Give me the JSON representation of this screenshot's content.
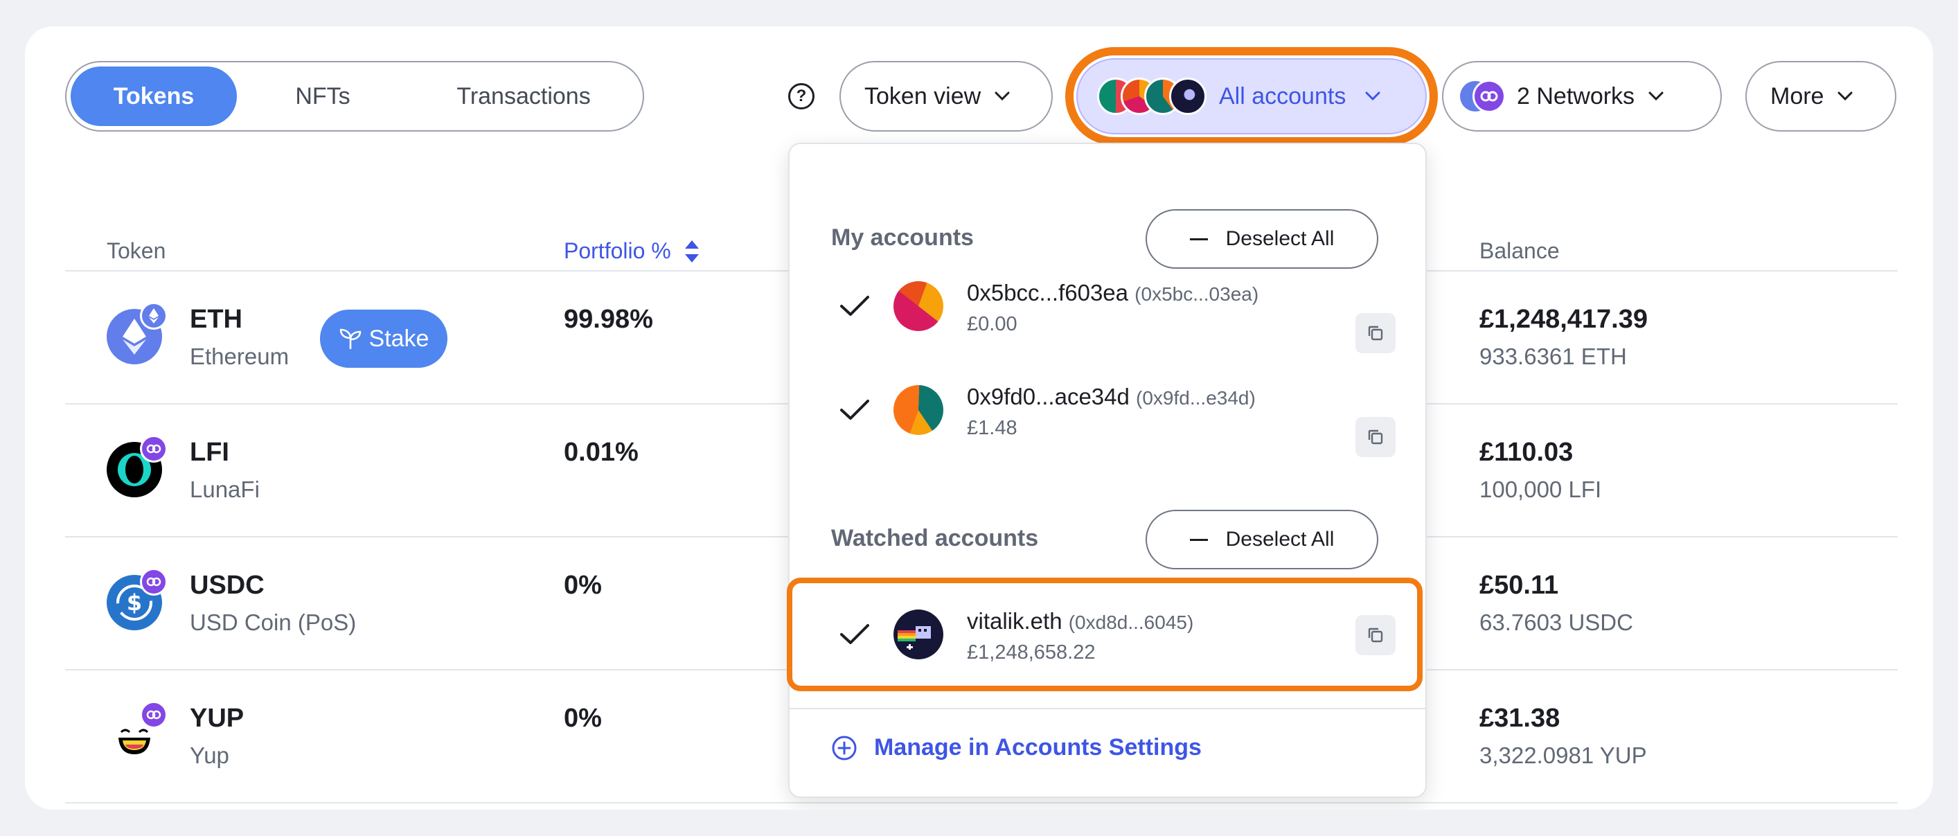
{
  "tabs": [
    {
      "label": "Tokens"
    },
    {
      "label": "NFTs"
    },
    {
      "label": "Transactions"
    }
  ],
  "toolbar": {
    "help_symbol": "?",
    "token_view_label": "Token view",
    "all_accounts_label": "All accounts",
    "networks_label": "2 Networks",
    "more_label": "More"
  },
  "table": {
    "headers": {
      "token": "Token",
      "portfolio": "Portfolio %",
      "balance": "Balance"
    },
    "rows": [
      {
        "symbol": "ETH",
        "name": "Ethereum",
        "portfolio": "99.98%",
        "balance": "£1,248,417.39",
        "amount": "933.6361 ETH"
      },
      {
        "symbol": "LFI",
        "name": "LunaFi",
        "portfolio": "0.01%",
        "balance": "£110.03",
        "amount": "100,000 LFI"
      },
      {
        "symbol": "USDC",
        "name": "USD Coin (PoS)",
        "portfolio": "0%",
        "balance": "£50.11",
        "amount": "63.7603 USDC"
      },
      {
        "symbol": "YUP",
        "name": "Yup",
        "portfolio": "0%",
        "balance": "£31.38",
        "amount": "3,322.0981 YUP"
      }
    ],
    "stake_label": "Stake"
  },
  "dropdown": {
    "my_accounts_title": "My accounts",
    "watched_accounts_title": "Watched accounts",
    "deselect_label": "Deselect All",
    "my_accounts": [
      {
        "name": "0x5bcc...f603ea",
        "short": "(0x5bc...03ea)",
        "balance": "£0.00"
      },
      {
        "name": "0x9fd0...ace34d",
        "short": "(0x9fd...e34d)",
        "balance": "£1.48"
      }
    ],
    "watched_accounts": [
      {
        "name": "vitalik.eth",
        "short": "(0xd8d...6045)",
        "balance": "£1,248,658.22"
      }
    ],
    "manage_label": "Manage in Accounts Settings"
  },
  "colors": {
    "accent": "#4f86ef",
    "link": "#3e55e6",
    "highlight": "#f27b12",
    "selected_bg": "#dfe0ff"
  }
}
